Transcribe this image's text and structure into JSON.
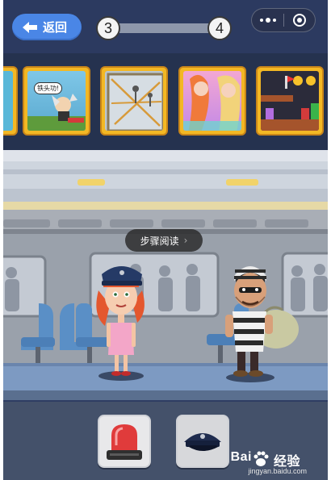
{
  "header": {
    "back_label": "返回",
    "level_current": "3",
    "level_next": "4",
    "progress": 0.0
  },
  "game_strip": {
    "cards": [
      {
        "id": "card-partial",
        "theme": "partial"
      },
      {
        "id": "card-iron-head",
        "badge": "铁头功!"
      },
      {
        "id": "card-ropes"
      },
      {
        "id": "card-mermaid-hair"
      },
      {
        "id": "card-platformer"
      }
    ]
  },
  "overlay": {
    "step_label": "步骤阅读",
    "chevron": "›"
  },
  "items": [
    {
      "name": "police-siren",
      "icon": "siren-icon"
    },
    {
      "name": "police-hat",
      "icon": "police-hat-icon"
    }
  ],
  "watermark": {
    "brand": "Bai",
    "brand_suffix": "经验",
    "url": "jingyan.baidu.com"
  },
  "colors": {
    "back_button": "#4a86e6",
    "card_frame": "#f3b824",
    "scene_floor": "#7d9ac2",
    "train_wall": "#9aa1ab"
  }
}
